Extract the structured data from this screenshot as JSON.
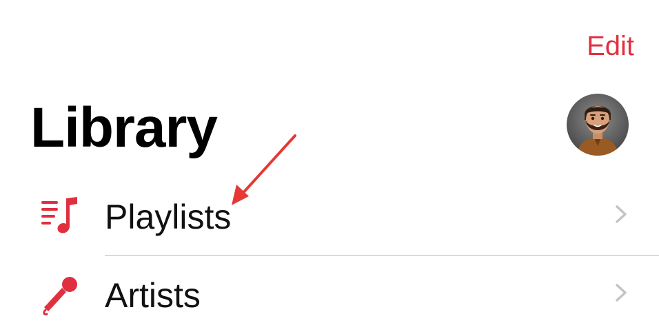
{
  "header": {
    "edit_label": "Edit",
    "title": "Library"
  },
  "avatar": {
    "icon": "memoji-avatar-icon"
  },
  "library": {
    "items": [
      {
        "label": "Playlists",
        "icon": "playlist-icon"
      },
      {
        "label": "Artists",
        "icon": "microphone-icon"
      }
    ]
  },
  "colors": {
    "accent": "#e0303f",
    "chevron": "#c4c4c6",
    "divider": "#d9d9d9",
    "annotation": "#e53935"
  }
}
